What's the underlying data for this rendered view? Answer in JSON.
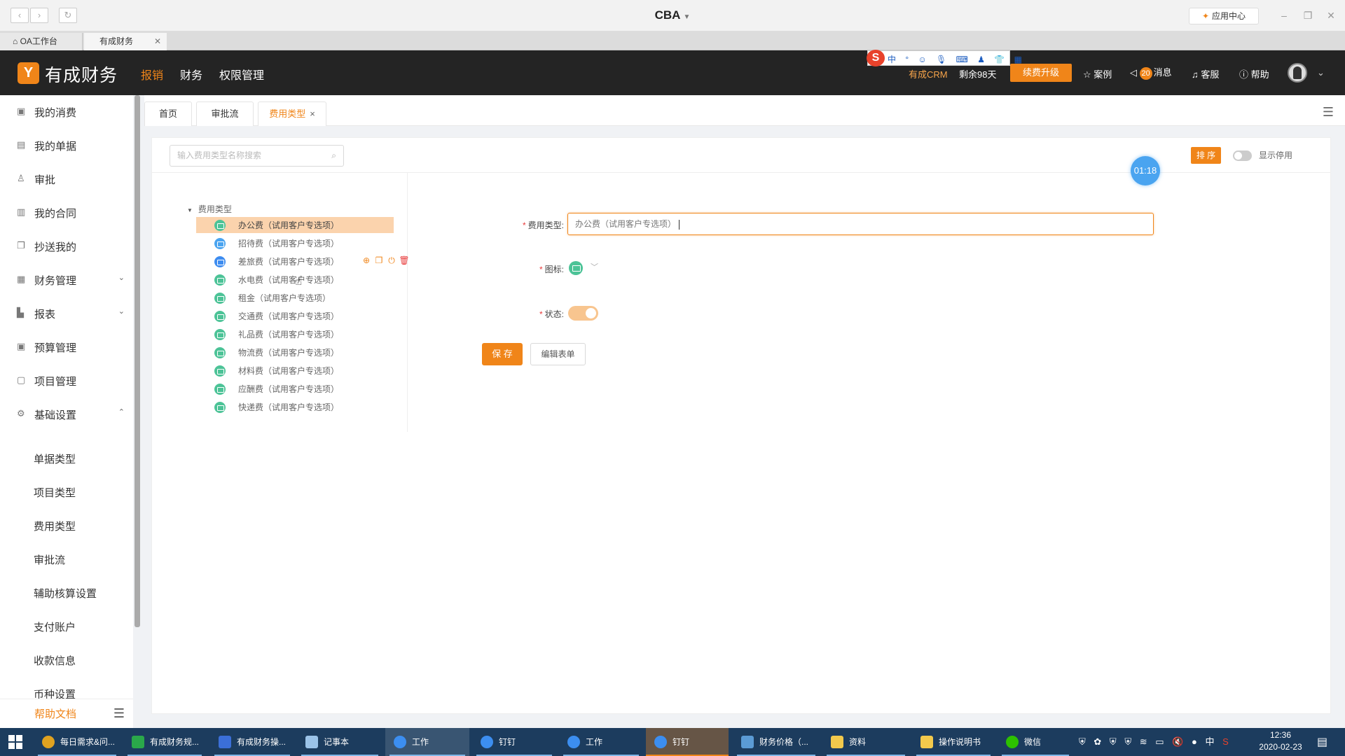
{
  "browser": {
    "title": "CBA",
    "app_center_label": "应用中心",
    "tabs": [
      {
        "label": "OA工作台"
      },
      {
        "label": "有成财务"
      }
    ]
  },
  "header": {
    "logo_letter": "Y",
    "brand": "有成财务",
    "nav": [
      {
        "label": "报销",
        "active": true
      },
      {
        "label": "财务",
        "active": false
      },
      {
        "label": "权限管理",
        "active": false
      }
    ],
    "crm_label": "有成CRM",
    "remaining": "剩余98天",
    "upgrade_label": "续费升级",
    "case_label": "案例",
    "message_count": "20",
    "message_label": "消息",
    "service_label": "客服",
    "help_label": "帮助",
    "ime_items": "中 ° ☺ 🎙 ⌨ ♟ 👕 ▦"
  },
  "sidebar": {
    "items": [
      {
        "label": "我的消费",
        "icon": "receipt-icon"
      },
      {
        "label": "我的单据",
        "icon": "document-icon"
      },
      {
        "label": "审批",
        "icon": "user-icon"
      },
      {
        "label": "我的合同",
        "icon": "contract-icon"
      },
      {
        "label": "抄送我的",
        "icon": "copy-icon"
      },
      {
        "label": "财务管理",
        "icon": "finance-icon",
        "expandable": true
      },
      {
        "label": "报表",
        "icon": "chart-icon",
        "expandable": true
      },
      {
        "label": "预算管理",
        "icon": "budget-icon"
      },
      {
        "label": "项目管理",
        "icon": "project-icon"
      },
      {
        "label": "基础设置",
        "icon": "gear-icon",
        "expanded": true
      }
    ],
    "sub_items": [
      {
        "label": "单据类型"
      },
      {
        "label": "项目类型"
      },
      {
        "label": "费用类型"
      },
      {
        "label": "审批流"
      },
      {
        "label": "辅助核算设置"
      },
      {
        "label": "支付账户"
      },
      {
        "label": "收款信息"
      },
      {
        "label": "币种设置"
      }
    ],
    "help_doc": "帮助文档"
  },
  "page_tabs": [
    {
      "label": "首页"
    },
    {
      "label": "审批流"
    },
    {
      "label": "费用类型",
      "active": true
    }
  ],
  "toolbar": {
    "search_placeholder": "输入费用类型名称搜索",
    "sort_label": "排 序",
    "show_disabled_label": "显示停用",
    "timer": "01:18"
  },
  "tree": {
    "root_label": "费用类型",
    "items": [
      {
        "label": "办公费（试用客户专选项）",
        "selected": true
      },
      {
        "label": "招待费（试用客户专选项）"
      },
      {
        "label": "差旅费（试用客户专选项）",
        "hovered": true
      },
      {
        "label": "水电费（试用客户专选项）"
      },
      {
        "label": "租金（试用客户专选项）"
      },
      {
        "label": "交通费（试用客户专选项）"
      },
      {
        "label": "礼品费（试用客户专选项）"
      },
      {
        "label": "物流费（试用客户专选项）"
      },
      {
        "label": "材料费（试用客户专选项）"
      },
      {
        "label": "应酬费（试用客户专选项）"
      },
      {
        "label": "快递费（试用客户专选项）"
      }
    ]
  },
  "form": {
    "fee_type_label": "费用类型:",
    "fee_type_value": "办公费（试用客户专选项）",
    "icon_label": "图标:",
    "status_label": "状态:",
    "status_enabled": true,
    "save_label": "保 存",
    "edit_form_label": "编辑表单"
  },
  "taskbar": {
    "tasks": [
      {
        "label": "每日需求&问..."
      },
      {
        "label": "有成财务规..."
      },
      {
        "label": "有成财务操..."
      },
      {
        "label": "记事本"
      },
      {
        "label": "工作"
      },
      {
        "label": "钉钉"
      },
      {
        "label": "工作"
      },
      {
        "label": "钉钉"
      },
      {
        "label": "财务价格（..."
      },
      {
        "label": "资料"
      },
      {
        "label": "操作说明书"
      },
      {
        "label": "微信"
      }
    ],
    "ime_indicator": "中",
    "time": "12:36",
    "date": "2020-02-23"
  }
}
